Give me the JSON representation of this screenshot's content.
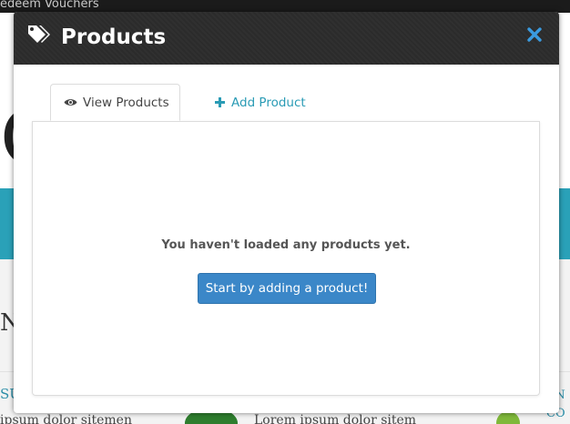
{
  "background_page": {
    "topbar_text": "edeem Vouchers",
    "big_letter": "C",
    "section_letter": "N",
    "left_link_fragment": "SU",
    "right_link_fragment": "AN CO",
    "lorem_left": "ipsum dolor sitemen",
    "lorem_right": "Lorem ipsum dolor sitem"
  },
  "modal": {
    "title": "Products",
    "title_icon": "tags-icon",
    "close_icon": "close-icon",
    "tabs": [
      {
        "label": "View Products",
        "icon": "eye-icon",
        "active": true
      },
      {
        "label": "Add Product",
        "icon": "plus-icon",
        "active": false
      }
    ],
    "empty_state": {
      "message": "You haven't loaded any products yet.",
      "button_label": "Start by adding a product!"
    }
  },
  "colors": {
    "header_bg": "#2b2b2b",
    "accent_blue": "#3b87c8",
    "close_blue": "#3a9be0",
    "link_teal": "#2a9bb5",
    "band_teal": "#2aa1b8"
  }
}
